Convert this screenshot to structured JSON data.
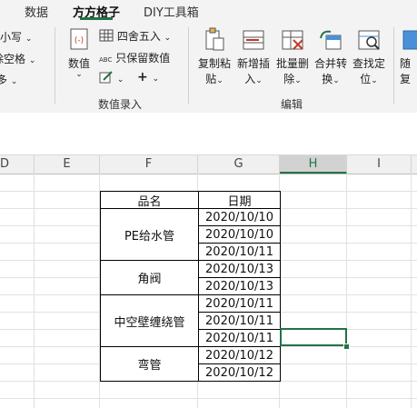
{
  "tabs": [
    {
      "label": "数据"
    },
    {
      "label": "方方格子"
    },
    {
      "label": "DIY工具箱"
    }
  ],
  "ribbon": {
    "left_cut": {
      "row1": "小写",
      "row2": "除空格",
      "row3": "多"
    },
    "value_group": {
      "value_button": "数值",
      "round": "四舍五入",
      "keep_values": "只保留数值",
      "abc": "ABC",
      "label": "数值录入"
    },
    "edit_group": {
      "copy_paste": {
        "line1": "复制粘",
        "line2": "贴"
      },
      "add_insert": {
        "line1": "新增插",
        "line2": "入"
      },
      "batch_delete": {
        "line1": "批量删",
        "line2": "除"
      },
      "merge_convert": {
        "line1": "合并转",
        "line2": "换"
      },
      "find_locate": {
        "line1": "查找定",
        "line2": "位"
      },
      "random": {
        "line1": "随",
        "line2": "复"
      },
      "label": "编辑"
    }
  },
  "columns": [
    "D",
    "E",
    "F",
    "G",
    "H",
    "I"
  ],
  "table": {
    "headers": {
      "name": "品名",
      "date": "日期"
    },
    "groups": [
      {
        "name": "PE给水管",
        "dates": [
          "2020/10/10",
          "2020/10/10",
          "2020/10/11"
        ]
      },
      {
        "name": "角阀",
        "dates": [
          "2020/10/13",
          "2020/10/13"
        ]
      },
      {
        "name": "中空壁缠绕管",
        "dates": [
          "2020/10/11",
          "2020/10/11",
          "2020/10/11"
        ]
      },
      {
        "name": "弯管",
        "dates": [
          "2020/10/12",
          "2020/10/12"
        ]
      }
    ]
  },
  "colors": {
    "accent": "#217346"
  }
}
